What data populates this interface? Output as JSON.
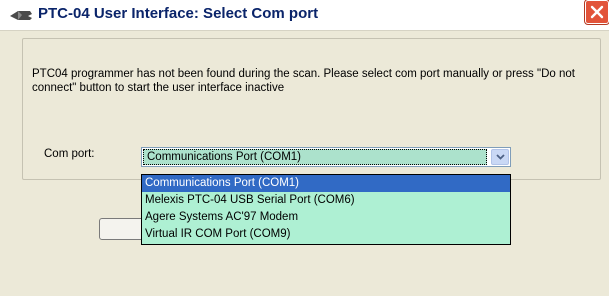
{
  "window": {
    "title": "PTC-04 User Interface: Select Com port",
    "icon": "app-icon",
    "close_icon": "close-icon"
  },
  "dialog": {
    "message": "PTC04 programmer has not been found during the scan. Please select com port manually or press \"Do not connect\" button to start the user interface inactive",
    "com_port_label": "Com port:",
    "com_port_selected": "Communications Port (COM1)",
    "com_port_options": [
      "Communications Port (COM1)",
      "Melexis PTC-04 USB Serial Port (COM6)",
      "Agere Systems AC'97 Modem",
      "Virtual IR COM Port (COM9)"
    ]
  },
  "colors": {
    "title_text": "#0a246a",
    "selection_bg": "#316ac5",
    "list_bg": "#aef0d3",
    "close_button": "#e2543a"
  }
}
